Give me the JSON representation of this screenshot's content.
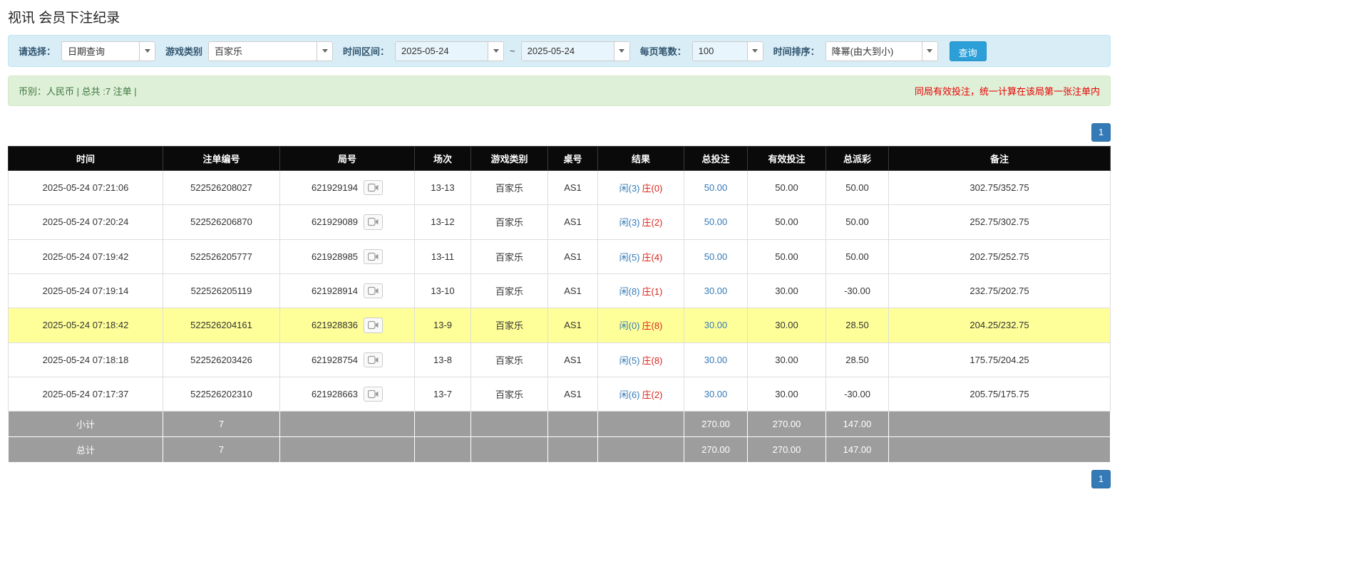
{
  "page": {
    "title": "视讯 会员下注纪录"
  },
  "filters": {
    "select_label": "请选择：",
    "select_value": "日期查询",
    "game_label": "游戏类别",
    "game_value": "百家乐",
    "range_label": "时间区间：",
    "date_from": "2025-05-24",
    "range_separator": "~",
    "date_to": "2025-05-24",
    "per_page_label": "每页笔数：",
    "per_page_value": "100",
    "sort_label": "时间排序：",
    "sort_value": "降幂(由大到小)",
    "search_button": "查询"
  },
  "summary": {
    "currency_info": "币别：人民币 | 总共 :7 注单 |",
    "notice": "同局有效投注，统一计算在该局第一张注单内"
  },
  "pagination": {
    "page_top": "1",
    "page_bottom": "1"
  },
  "table": {
    "headers": [
      "时间",
      "注单编号",
      "局号",
      "场次",
      "游戏类别",
      "桌号",
      "结果",
      "总投注",
      "有效投注",
      "总派彩",
      "备注"
    ],
    "rows": [
      {
        "time": "2025-05-24 07:21:06",
        "bet_id": "522526208027",
        "round_id": "621929194",
        "session": "13-13",
        "game": "百家乐",
        "table": "AS1",
        "result_player": "闲(3)",
        "result_banker": "庄(0)",
        "total_bet": "50.00",
        "valid_bet": "50.00",
        "payout": "50.00",
        "note": "302.75/352.75",
        "highlight": false
      },
      {
        "time": "2025-05-24 07:20:24",
        "bet_id": "522526206870",
        "round_id": "621929089",
        "session": "13-12",
        "game": "百家乐",
        "table": "AS1",
        "result_player": "闲(3)",
        "result_banker": "庄(2)",
        "total_bet": "50.00",
        "valid_bet": "50.00",
        "payout": "50.00",
        "note": "252.75/302.75",
        "highlight": false
      },
      {
        "time": "2025-05-24 07:19:42",
        "bet_id": "522526205777",
        "round_id": "621928985",
        "session": "13-11",
        "game": "百家乐",
        "table": "AS1",
        "result_player": "闲(5)",
        "result_banker": "庄(4)",
        "total_bet": "50.00",
        "valid_bet": "50.00",
        "payout": "50.00",
        "note": "202.75/252.75",
        "highlight": false
      },
      {
        "time": "2025-05-24 07:19:14",
        "bet_id": "522526205119",
        "round_id": "621928914",
        "session": "13-10",
        "game": "百家乐",
        "table": "AS1",
        "result_player": "闲(8)",
        "result_banker": "庄(1)",
        "total_bet": "30.00",
        "valid_bet": "30.00",
        "payout": "-30.00",
        "note": "232.75/202.75",
        "highlight": false
      },
      {
        "time": "2025-05-24 07:18:42",
        "bet_id": "522526204161",
        "round_id": "621928836",
        "session": "13-9",
        "game": "百家乐",
        "table": "AS1",
        "result_player": "闲(0)",
        "result_banker": "庄(8)",
        "total_bet": "30.00",
        "valid_bet": "30.00",
        "payout": "28.50",
        "note": "204.25/232.75",
        "highlight": true
      },
      {
        "time": "2025-05-24 07:18:18",
        "bet_id": "522526203426",
        "round_id": "621928754",
        "session": "13-8",
        "game": "百家乐",
        "table": "AS1",
        "result_player": "闲(5)",
        "result_banker": "庄(8)",
        "total_bet": "30.00",
        "valid_bet": "30.00",
        "payout": "28.50",
        "note": "175.75/204.25",
        "highlight": false
      },
      {
        "time": "2025-05-24 07:17:37",
        "bet_id": "522526202310",
        "round_id": "621928663",
        "session": "13-7",
        "game": "百家乐",
        "table": "AS1",
        "result_player": "闲(6)",
        "result_banker": "庄(2)",
        "total_bet": "30.00",
        "valid_bet": "30.00",
        "payout": "-30.00",
        "note": "205.75/175.75",
        "highlight": false
      }
    ],
    "subtotal": {
      "label": "小计",
      "count": "7",
      "total_bet": "270.00",
      "valid_bet": "270.00",
      "payout": "147.00"
    },
    "total": {
      "label": "总计",
      "count": "7",
      "total_bet": "270.00",
      "valid_bet": "270.00",
      "payout": "147.00"
    }
  },
  "colors": {
    "accent_blue": "#337ab7",
    "player_blue": "#337ab7",
    "banker_red": "#d9261c",
    "negative_red": "#e60000",
    "highlight_yellow": "#ffff99",
    "header_black": "#0a0a0a",
    "footer_gray": "#9d9d9d",
    "filter_bar_blue": "#d9edf7",
    "summary_bar_green": "#dff0d8"
  },
  "icons": {
    "video_icon": "video-icon",
    "caret_icon": "chevron-down-icon"
  }
}
